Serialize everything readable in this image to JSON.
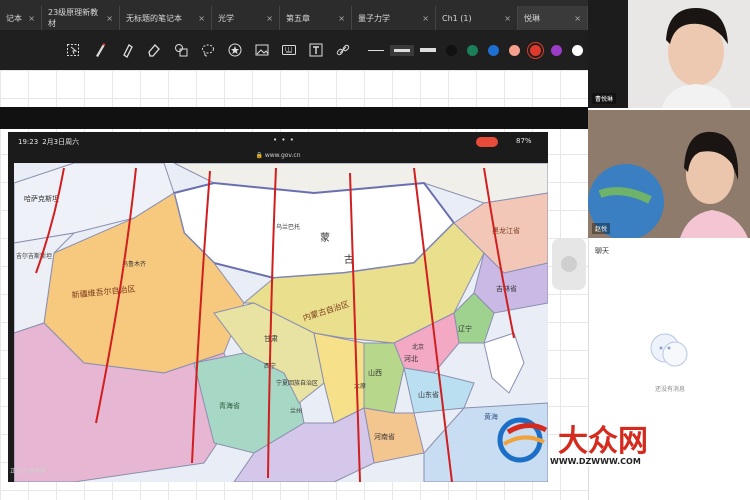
{
  "tabs": [
    {
      "label": "记本"
    },
    {
      "label": "23级原理新教材"
    },
    {
      "label": "无标题的笔记本"
    },
    {
      "label": "光学"
    },
    {
      "label": "第五章"
    },
    {
      "label": "量子力学"
    },
    {
      "label": "Ch1 (1)"
    },
    {
      "label": "悦琳"
    }
  ],
  "tab_close_glyph": "×",
  "toolbar": {
    "tools": [
      "select-icon",
      "pen-icon",
      "highlighter-icon",
      "eraser-icon",
      "shape-icon",
      "lasso-icon",
      "sticker-icon",
      "image-icon",
      "keyboard-icon",
      "text-icon",
      "link-icon"
    ],
    "colors": [
      "#111111",
      "#1b7f5a",
      "#1d6fd1",
      "#f4a08c",
      "#e0392b",
      "#9b3cc7",
      "#ffffff",
      "#a8d8f0",
      "#f0f0f0"
    ]
  },
  "screenshare": {
    "time": "19:23",
    "date": "2月3日周六",
    "url": "www.gov.cn",
    "battery": "87%",
    "share_text": "正在共享屏幕"
  },
  "map": {
    "labels": {
      "mongolia_north": "蒙",
      "mongolia_south": "古",
      "ulaanbaatar": "乌兰巴托",
      "xinjiang": "新疆维吾尔自治区",
      "urumqi": "乌鲁木齐",
      "kazakhstan": "哈萨克斯坦",
      "kyrgyzstan": "吉尔吉斯斯坦",
      "nei_menggu": "内蒙古自治区",
      "qinghai": "青海省",
      "gansu": "甘肃",
      "heilongjiang": "黑龙江省",
      "jilin": "吉林省",
      "liaoning": "辽宁",
      "beijing": "北京",
      "hebei": "河北",
      "shanxi": "山西",
      "shandong": "山东省",
      "henan": "河南省",
      "ningxia": "宁夏回族自治区",
      "xining": "西宁",
      "lanzhou": "兰州",
      "taiyuan": "太原",
      "yellow_sea": "黄海"
    }
  },
  "participants": [
    {
      "name": "曹悦琳"
    },
    {
      "name": "赵悦"
    }
  ],
  "chat": {
    "title": "聊天",
    "empty_text": "还没有消息"
  },
  "watermark": {
    "brand": "大众网",
    "url": "WWW.DZWWW.COM"
  }
}
